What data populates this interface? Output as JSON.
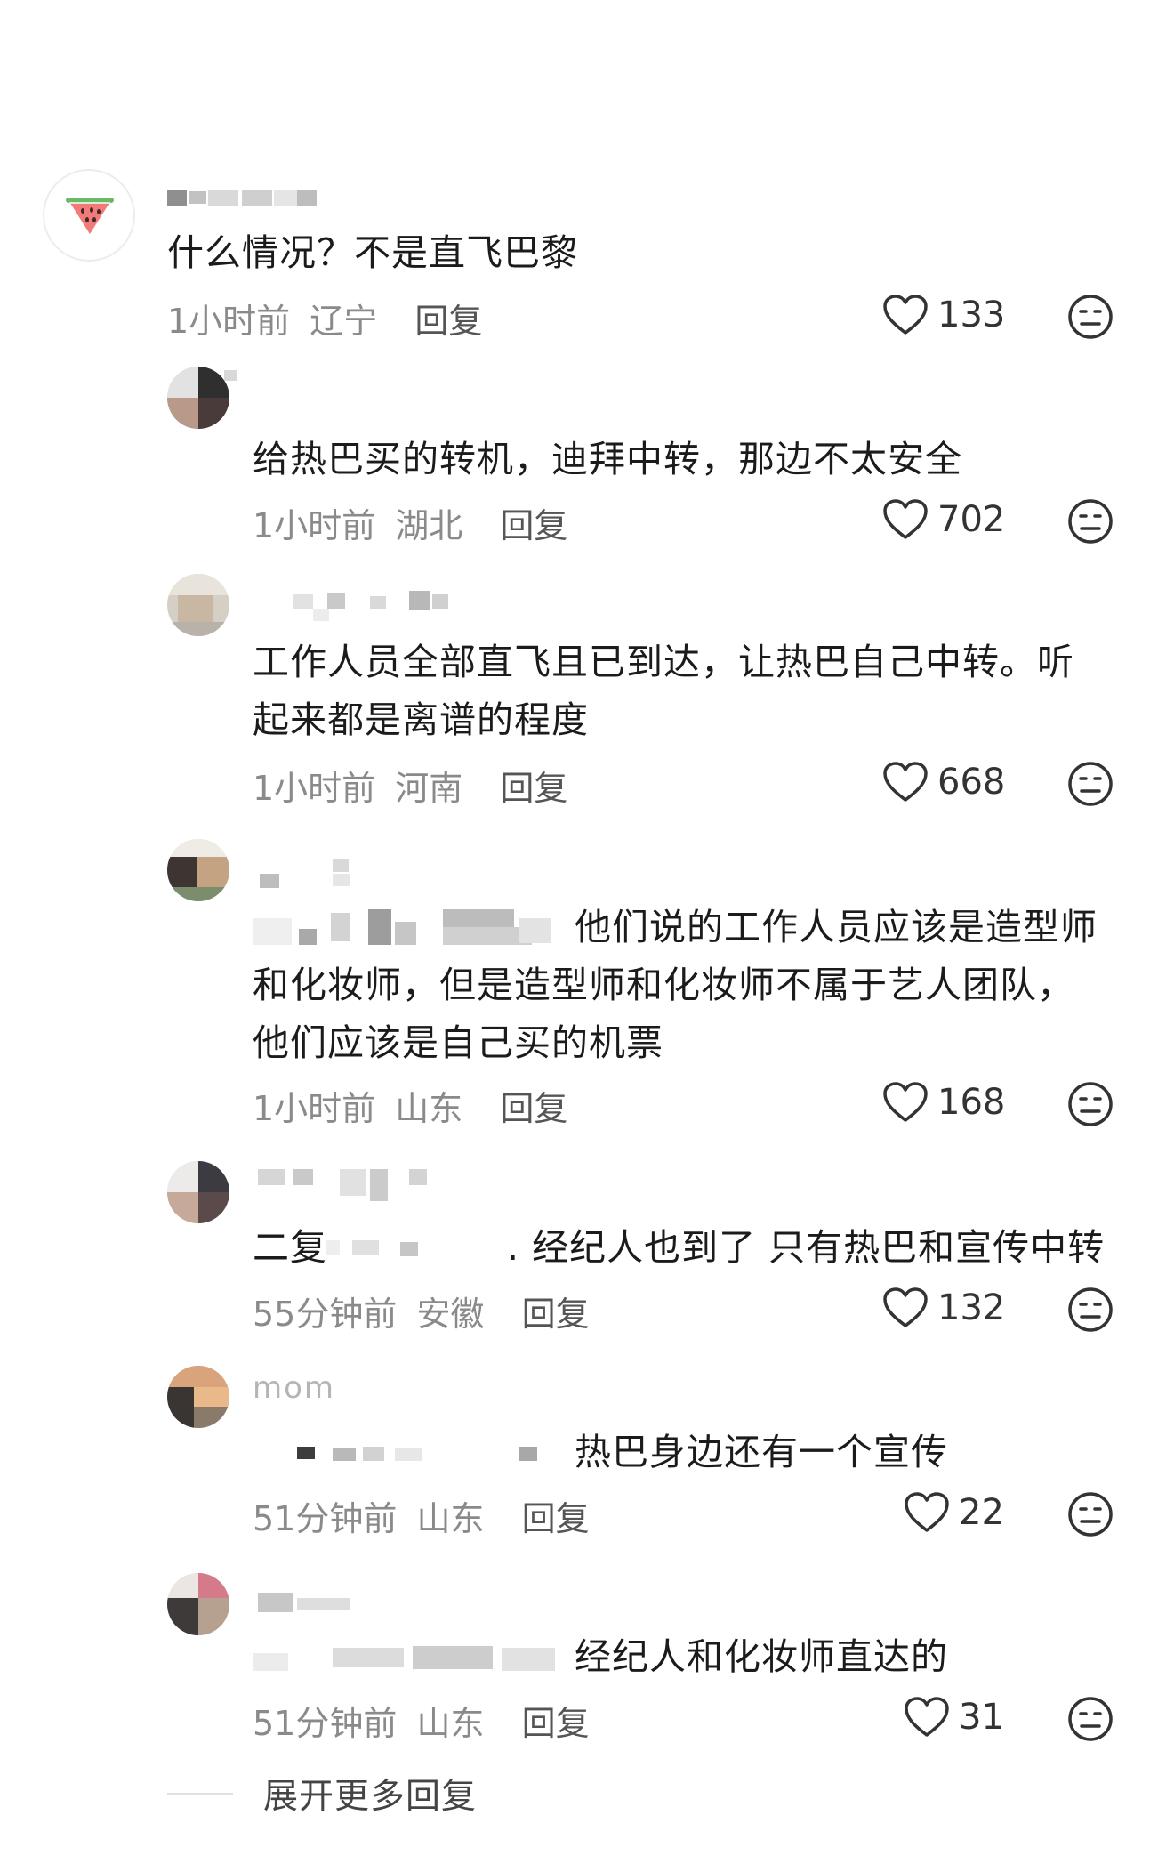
{
  "comments": [
    {
      "text": "什么情况？不是直飞巴黎",
      "time": "1小时前",
      "location": "辽宁",
      "reply_label": "回复",
      "likes": "133"
    },
    {
      "text": "给热巴买的转机，迪拜中转，那边不太安全",
      "time": "1小时前",
      "location": "湖北",
      "reply_label": "回复",
      "likes": "702"
    },
    {
      "text": "工作人员全部直飞且已到达，让热巴自己中转。听起来都是离谱的程度",
      "time": "1小时前",
      "location": "河南",
      "reply_label": "回复",
      "likes": "668"
    },
    {
      "text": "他们说的工作人员应该是造型师和化妆师，但是造型师和化妆师不属于艺人团队，他们应该是自己买的机票",
      "time": "1小时前",
      "location": "山东",
      "reply_label": "回复",
      "likes": "168"
    },
    {
      "text_prefix": "二复",
      "text": ". 经纪人也到了 只有热巴和宣传中转",
      "time": "55分钟前",
      "location": "安徽",
      "reply_label": "回复",
      "likes": "132"
    },
    {
      "username": "mom",
      "text": "热巴身边还有一个宣传",
      "time": "51分钟前",
      "location": "山东",
      "reply_label": "回复",
      "likes": "22"
    },
    {
      "text": "经纪人和化妆师直达的",
      "time": "51分钟前",
      "location": "山东",
      "reply_label": "回复",
      "likes": "31"
    }
  ],
  "more_replies_label": "展开更多回复",
  "icons": {
    "avatar_main": "watermelon-icon",
    "like": "heart-outline-icon",
    "dislike": "meh-face-icon"
  }
}
